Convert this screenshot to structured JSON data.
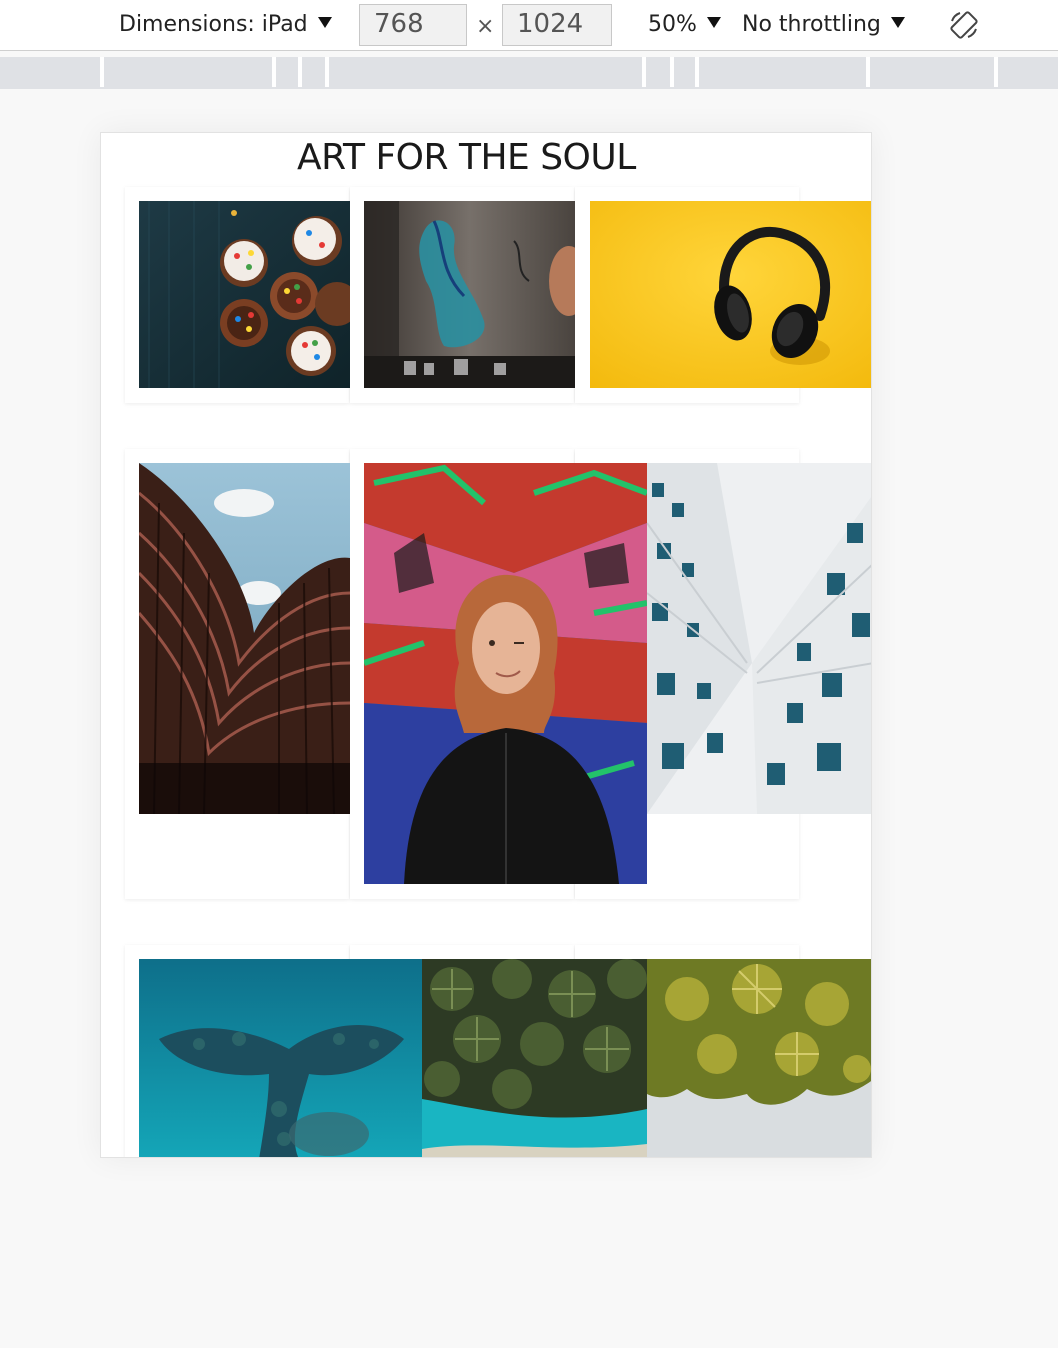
{
  "devtools": {
    "dimensions_label": "Dimensions: iPad",
    "width_value": "768",
    "times_sign": "×",
    "height_value": "1024",
    "zoom_label": "50%",
    "throttle_label": "No throttling",
    "rotate_icon": "rotate-device-icon"
  },
  "site": {
    "title": "ART FOR THE SOUL",
    "photos": [
      {
        "subject": "cupcakes",
        "colors": [
          "#1e3a45",
          "#d9c3a5"
        ]
      },
      {
        "subject": "street-mural",
        "colors": [
          "#2b2724",
          "#3a8fa0"
        ]
      },
      {
        "subject": "headphones",
        "colors": [
          "#f7c21a",
          "#111111"
        ]
      },
      {
        "subject": "curved-building",
        "colors": [
          "#8fb6cc",
          "#3a1f17"
        ]
      },
      {
        "subject": "girl-graffiti",
        "colors": [
          "#c43a2e",
          "#2a6fb0"
        ]
      },
      {
        "subject": "white-building",
        "colors": [
          "#e9ecee",
          "#1f5d73"
        ]
      },
      {
        "subject": "ocean-reef",
        "colors": [
          "#0f7f98",
          "#1c4e5e"
        ]
      },
      {
        "subject": "palm-trees-beach",
        "colors": [
          "#2d3a24",
          "#19b5c2"
        ]
      },
      {
        "subject": "palm-canopy",
        "colors": [
          "#9a9a2a",
          "#d9dde0"
        ]
      }
    ]
  }
}
